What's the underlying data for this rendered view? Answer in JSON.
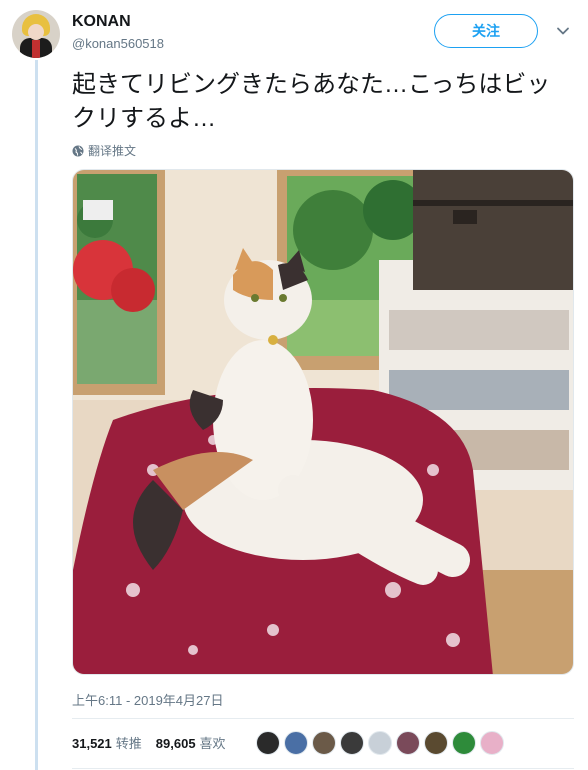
{
  "author": {
    "name": "KONAN",
    "handle": "@konan560518"
  },
  "follow_button": {
    "label": "关注"
  },
  "tweet": {
    "text": "起きてリビングきたらあなた…こっちはビックリするよ…",
    "translate_label": "翻译推文",
    "timestamp": "上午6:11 - 2019年4月27日"
  },
  "stats": {
    "retweets_count": "31,521",
    "retweets_label": "转推",
    "likes_count": "89,605",
    "likes_label": "喜欢"
  },
  "likers": [
    {
      "icon": "liker-avatar",
      "color": "#2a2a2a"
    },
    {
      "icon": "liker-avatar",
      "color": "#4a6fa5"
    },
    {
      "icon": "liker-avatar",
      "color": "#6b5a48"
    },
    {
      "icon": "liker-avatar",
      "color": "#3a3a3a"
    },
    {
      "icon": "liker-avatar",
      "color": "#c8d0d8"
    },
    {
      "icon": "liker-avatar",
      "color": "#7a4a5a"
    },
    {
      "icon": "liker-avatar",
      "color": "#5a4a30"
    },
    {
      "icon": "liker-avatar",
      "color": "#2e8b3a"
    },
    {
      "icon": "liker-avatar",
      "color": "#e8b0c8"
    }
  ],
  "colors": {
    "accent": "#1da1f2",
    "secondary_text": "#657786",
    "thread_line": "#cde0f0"
  }
}
